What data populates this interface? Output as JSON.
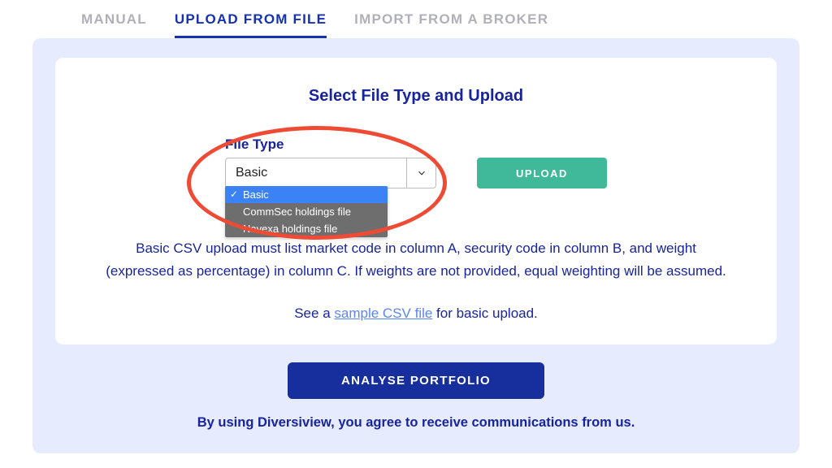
{
  "tabs": {
    "manual": "MANUAL",
    "upload": "UPLOAD FROM FILE",
    "broker": "IMPORT FROM A BROKER"
  },
  "card": {
    "title": "Select File Type and Upload",
    "file_type_label": "File Type",
    "file_type_value": "Basic",
    "dropdown_options": {
      "opt0": "Basic",
      "opt1": "CommSec holdings file",
      "opt2": "Navexa holdings file"
    },
    "upload_btn": "UPLOAD",
    "help_line1": "Basic CSV upload must list market code in column A, security code in column B, and weight",
    "help_line2": "(expressed as percentage) in column C. If weights are not provided, equal weighting will be assumed.",
    "sample_prefix": "See a ",
    "sample_link": "sample CSV file",
    "sample_suffix": " for basic upload."
  },
  "analyse_btn": "ANALYSE PORTFOLIO",
  "consent_text": "By using Diversiview, you agree to receive communications from us."
}
